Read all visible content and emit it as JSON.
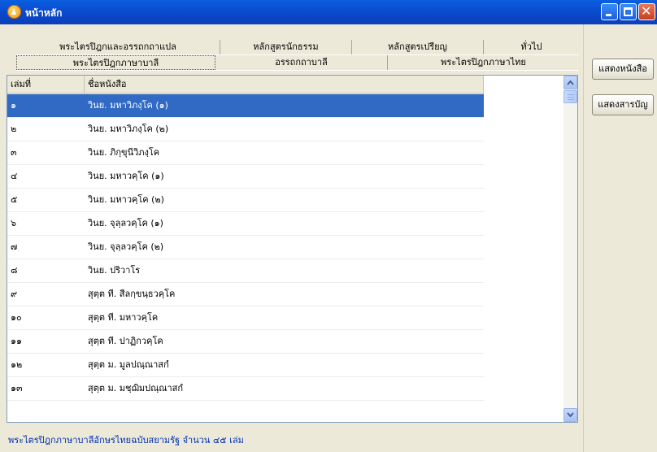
{
  "window": {
    "title": "หน้าหลัก"
  },
  "tabs": {
    "row1": [
      "พระไตรปิฎกและอรรถกถาแปล",
      "หลักสูตรนักธรรม",
      "หลักสูตรเปรียญ",
      "ทั่วไป"
    ],
    "row2": [
      "พระไตรปิฎกภาษาบาลี",
      "อรรถกถาบาลี",
      "พระไตรปิฎกภาษาไทย"
    ],
    "selected": "พระไตรปิฎกภาษาบาลี"
  },
  "table": {
    "columns": [
      "เล่มที่",
      "ชื่อหนังสือ"
    ],
    "rows": [
      {
        "no": "๑",
        "name": "วินย. มหาวิภงฺโค (๑)"
      },
      {
        "no": "๒",
        "name": "วินย. มหาวิภงฺโค (๒)"
      },
      {
        "no": "๓",
        "name": "วินย. ภิกฺขุนีวิภงฺโค"
      },
      {
        "no": "๔",
        "name": "วินย. มหาวคฺโค (๑)"
      },
      {
        "no": "๕",
        "name": "วินย. มหาวคฺโค (๒)"
      },
      {
        "no": "๖",
        "name": "วินย. จุลฺลวคฺโค (๑)"
      },
      {
        "no": "๗",
        "name": "วินย. จุลฺลวคฺโค (๒)"
      },
      {
        "no": "๘",
        "name": "วินย. ปริวาโร"
      },
      {
        "no": "๙",
        "name": "สุตฺต ที. สีลกฺขนฺธวคฺโค"
      },
      {
        "no": "๑๐",
        "name": "สุตฺต ที. มหาวคฺโค"
      },
      {
        "no": "๑๑",
        "name": "สุตฺต ที. ปาฏิกวคฺโค"
      },
      {
        "no": "๑๒",
        "name": "สุตฺต ม. มูลปณฺณาสกํ"
      },
      {
        "no": "๑๓",
        "name": "สุตฺต ม. มชฺฌิมปณฺณาสกํ"
      }
    ],
    "selected_index": 0
  },
  "buttons": {
    "show_book": "แสดงหนังสือ",
    "show_contents": "แสดงสารบัญ"
  },
  "status": "พระไตรปิฎกภาษาบาลีอักษรไทยฉบับสยามรัฐ จำนวน ๔๕ เล่ม",
  "colors": {
    "titlebar": "#0b4bd0",
    "selection": "#316ac5",
    "status_text": "#0030b0"
  }
}
